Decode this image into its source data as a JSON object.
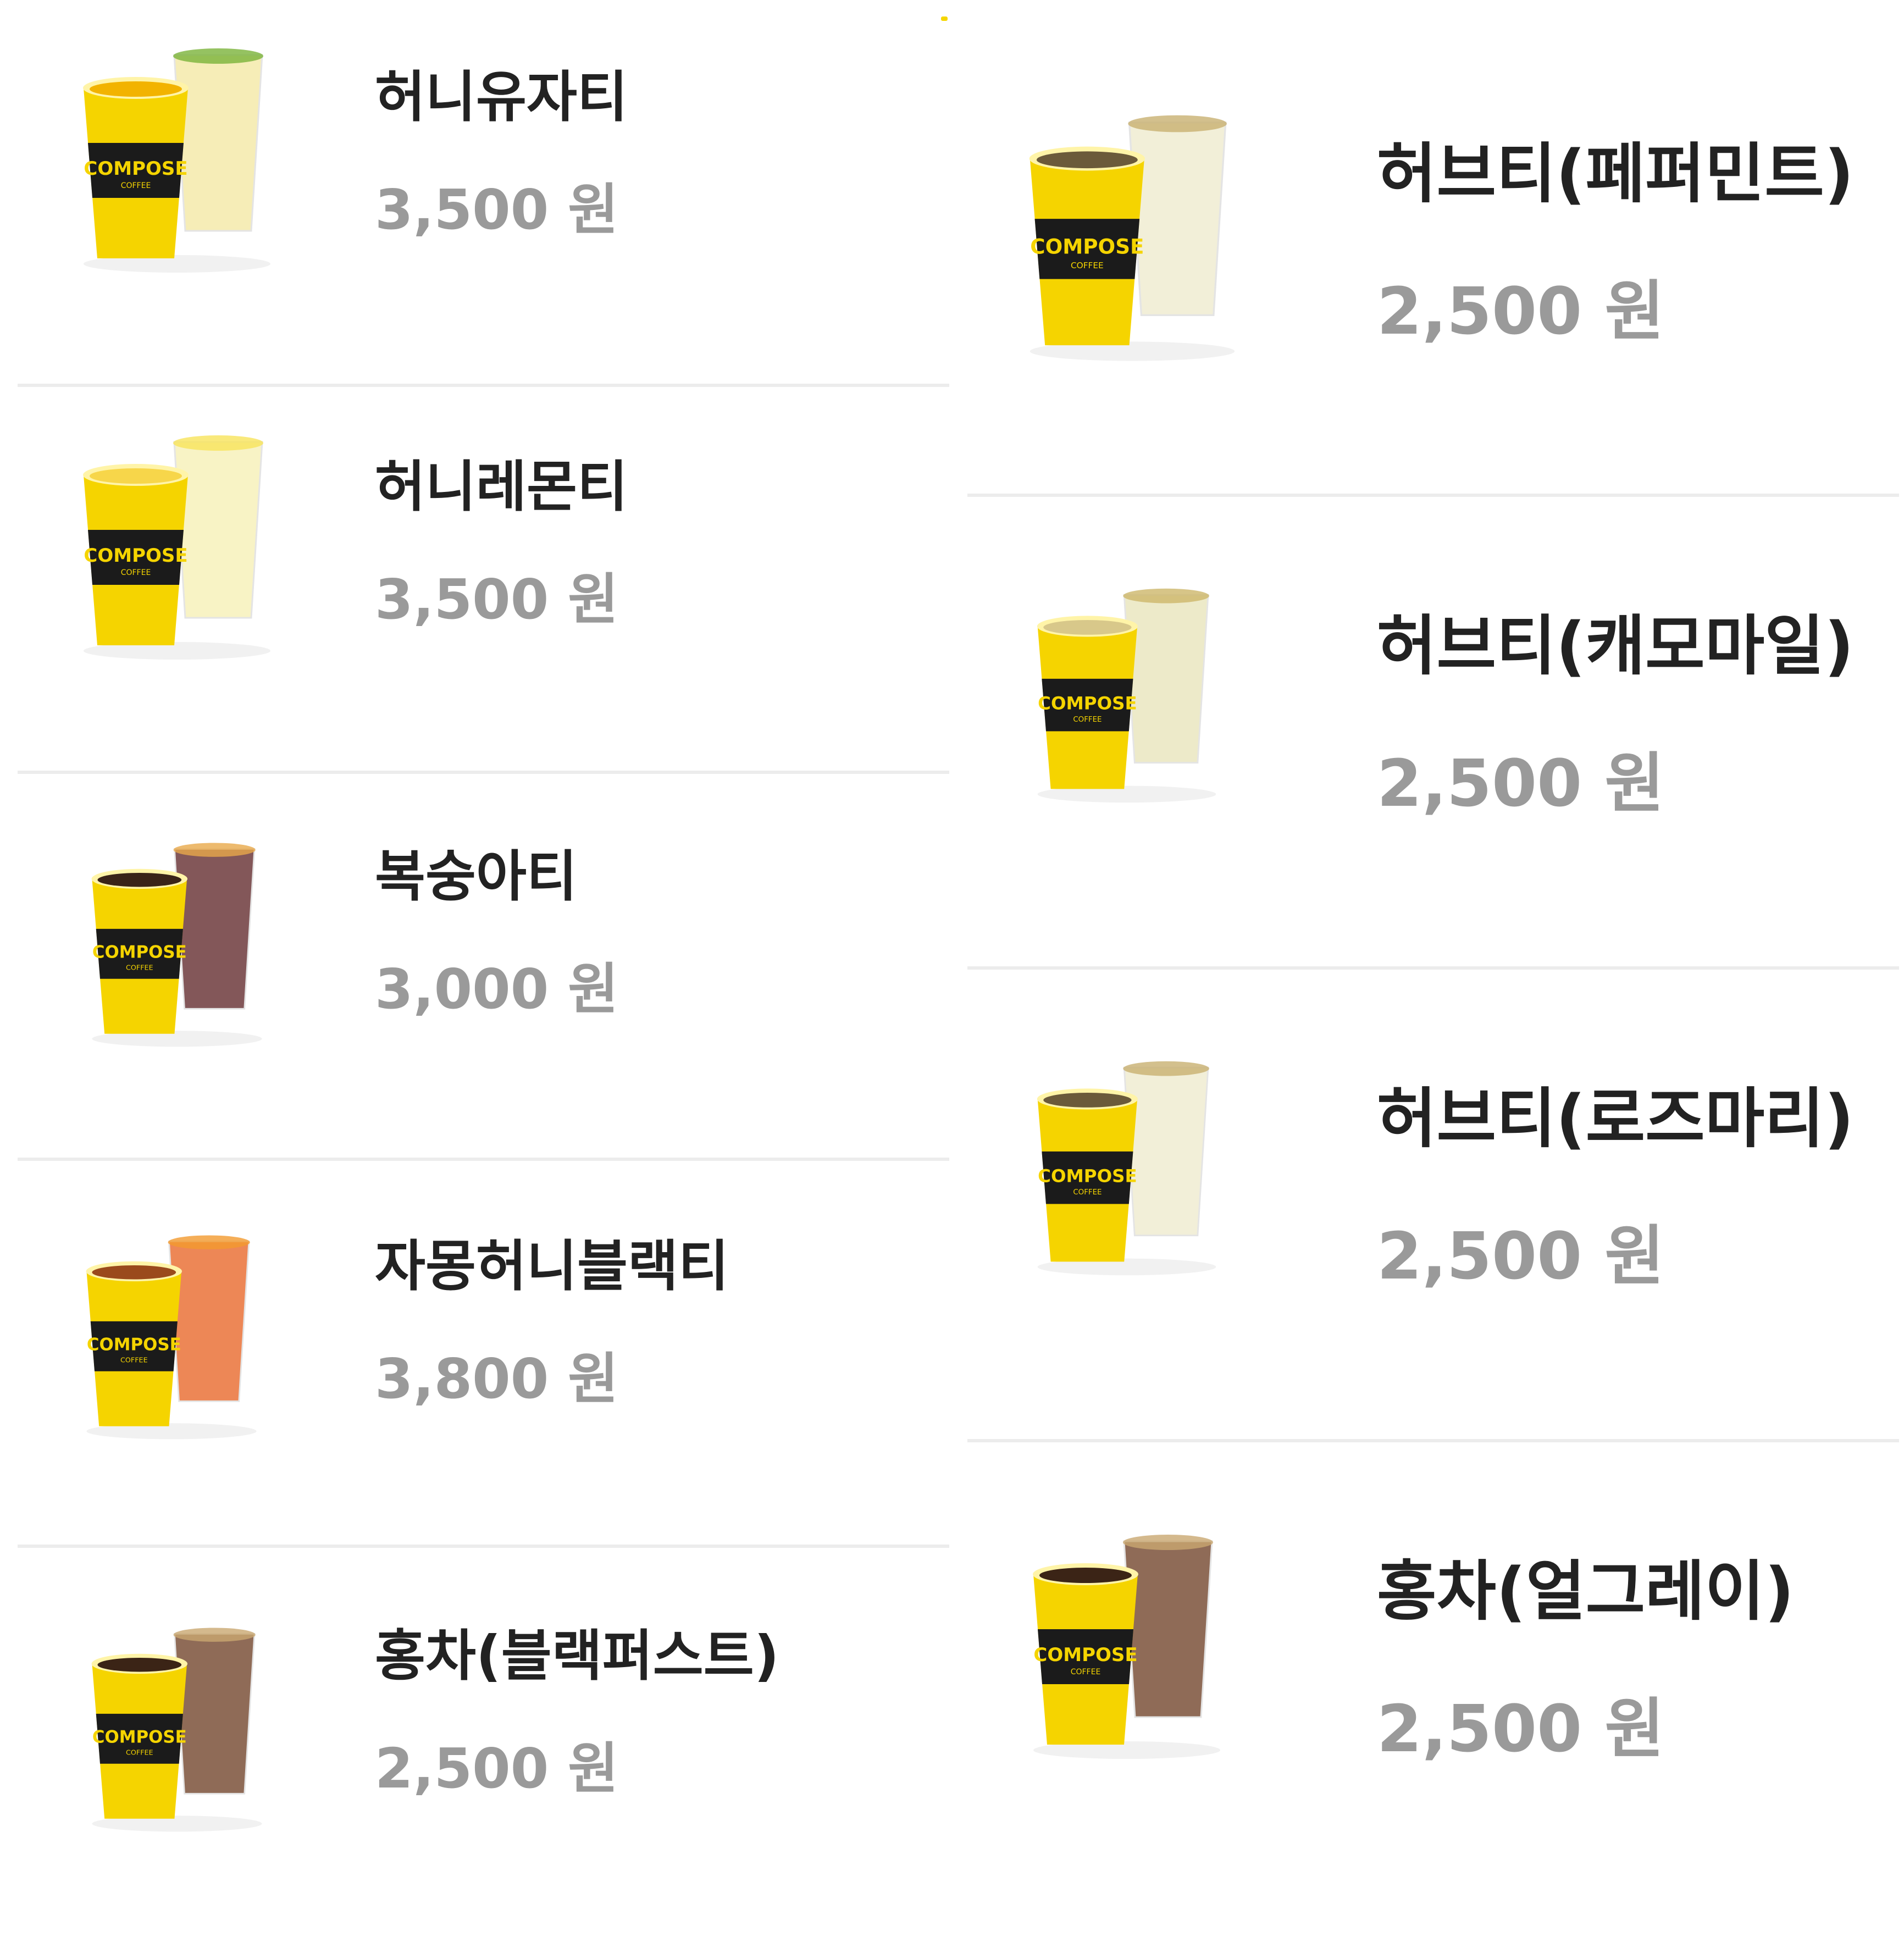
{
  "brand_text": "COMPOSE COFFEE",
  "colors": {
    "cup_yellow": "#f5d400",
    "sleeve_black": "#1b1b1b",
    "name_text": "#222222",
    "price_text": "#9a9a9a",
    "divider": "#ececec"
  },
  "left_column": [
    {
      "name": "허니유자티",
      "price": "3,500 원",
      "drink": "yuja"
    },
    {
      "name": "허니레몬티",
      "price": "3,500 원",
      "drink": "lemon"
    },
    {
      "name": "복숭아티",
      "price": "3,000 원",
      "drink": "peach"
    },
    {
      "name": "자몽허니블랙티",
      "price": "3,800 원",
      "drink": "grapefruit"
    },
    {
      "name": "홍차(블랙퍼스트)",
      "price": "2,500 원",
      "drink": "blacktea"
    }
  ],
  "right_column": [
    {
      "name": "허브티(페퍼민트)",
      "price": "2,500 원",
      "drink": "herb"
    },
    {
      "name": "허브티(캐모마일)",
      "price": "2,500 원",
      "drink": "chamomile"
    },
    {
      "name": "허브티(로즈마리)",
      "price": "2,500 원",
      "drink": "herb"
    },
    {
      "name": "홍차(얼그레이)",
      "price": "2,500 원",
      "drink": "blacktea"
    }
  ]
}
